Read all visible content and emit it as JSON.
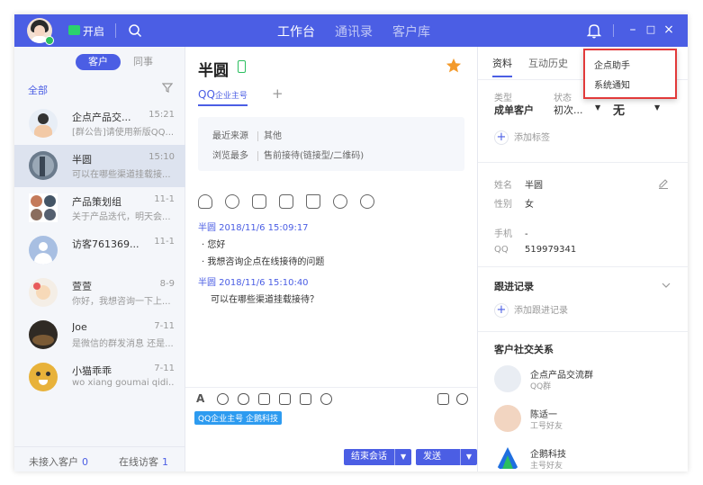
{
  "topbar": {
    "status_label": "开启",
    "nav": [
      "工作台",
      "通讯录",
      "客户库"
    ],
    "window_controls": [
      "–",
      "□",
      "×"
    ]
  },
  "left": {
    "segments": [
      "客户",
      "同事"
    ],
    "filter_label": "全部",
    "conversations": [
      {
        "name": "企点产品交...",
        "time": "15:21",
        "preview": "[群公告]请使用新版QQ..."
      },
      {
        "name": "半圆",
        "time": "15:10",
        "preview": "可以在哪些渠道挂载接..."
      },
      {
        "name": "产品策划组",
        "time": "11-1",
        "preview": "关于产品迭代，明天会..."
      },
      {
        "name": "访客761369...",
        "time": "11-1",
        "preview": ""
      },
      {
        "name": "萱萱",
        "time": "8-9",
        "preview": "你好，我想咨询一下上..."
      },
      {
        "name": "Joe",
        "time": "7-11",
        "preview": "是微信的群发消息 还是..."
      },
      {
        "name": "小猫乖乖",
        "time": "7-11",
        "preview": "wo xiang goumai qidi..."
      }
    ],
    "bottom": {
      "waiting_label": "未接入客户",
      "waiting_count": "0",
      "online_label": "在线访客",
      "online_count": "1"
    }
  },
  "chat": {
    "title": "半圆",
    "tab_label": "QQ",
    "tab_sub": "企业主号",
    "plus": "+",
    "info": {
      "source_label": "最近来源",
      "source_value": "其他",
      "browse_label": "浏览最多",
      "browse_value": "售前接待(链接型/二维码)"
    },
    "messages": [
      {
        "meta": "半圆 2018/11/6 15:09:17",
        "lines": [
          "· 您好",
          "· 我想咨询企点在线接待的问题"
        ]
      },
      {
        "meta": "半圆 2018/11/6 15:10:40",
        "lines": [
          "可以在哪些渠道挂载接待？"
        ]
      }
    ],
    "composer": {
      "chip": "QQ企业主号 企鹅科技",
      "end_label": "结束会话",
      "send_label": "发送(S)"
    }
  },
  "profile": {
    "tabs": [
      "资料",
      "互动历史"
    ],
    "type_label": "类型",
    "type_value": "成单客户",
    "status_label": "状态",
    "status_value": "初次...",
    "third_value": "无",
    "add_tag": "添加标签",
    "fields": [
      {
        "k": "姓名",
        "v": "半圆"
      },
      {
        "k": "性别",
        "v": "女"
      },
      {
        "k": "手机",
        "v": "-"
      },
      {
        "k": "QQ",
        "v": "519979341"
      }
    ],
    "followup_title": "跟进记录",
    "add_followup": "添加跟进记录",
    "social_title": "客户社交关系",
    "social": [
      {
        "name": "企点产品交流群",
        "sub": "QQ群"
      },
      {
        "name": "陈适一",
        "sub": "工号好友"
      },
      {
        "name": "企鹅科技",
        "sub": "主号好友"
      }
    ]
  },
  "popup": {
    "items": [
      "企点助手",
      "系统通知"
    ]
  }
}
